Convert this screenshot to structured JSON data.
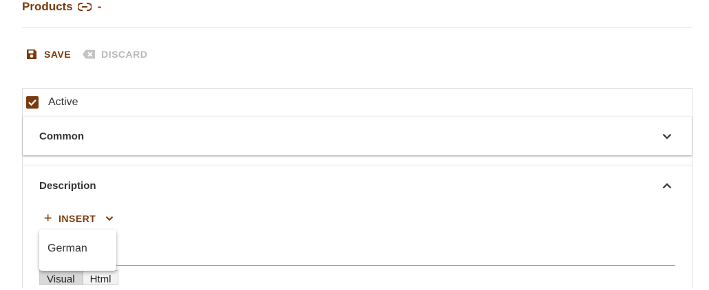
{
  "header": {
    "title": "Products",
    "separator": "-"
  },
  "toolbar": {
    "save_label": "SAVE",
    "discard_label": "DISCARD"
  },
  "form": {
    "active_label": "Active",
    "active_checked": true,
    "sections": {
      "common": {
        "title": "Common",
        "expanded": false
      },
      "description": {
        "title": "Description",
        "expanded": true
      }
    },
    "insert_label": "INSERT",
    "editor_tabs": [
      "Visual",
      "Html"
    ]
  },
  "insert_menu": {
    "items": [
      "German"
    ]
  },
  "colors": {
    "accent": "#7a3a0c",
    "disabled": "#b8b8b8"
  }
}
